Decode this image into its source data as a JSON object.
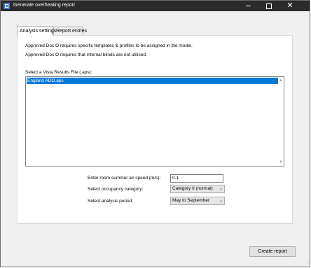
{
  "window": {
    "title": "Generate overheating report",
    "controls": {
      "minimize": "",
      "maximize": "",
      "close": "✕"
    }
  },
  "tabs": [
    {
      "label": "Analysis settings",
      "selected": true
    },
    {
      "label": "Report entries",
      "selected": false
    }
  ],
  "notes": [
    "Approved Doc O requires specific templates & profiles to be assigned in the model.",
    "Approved Doc O requires that internal blinds are not utilised."
  ],
  "results_file": {
    "label": "Select a Vista Results File (.aps):",
    "items": [
      {
        "name": "England ADO.aps",
        "selected": true
      }
    ]
  },
  "form": {
    "air_speed": {
      "label": "Enter room summer air speed (m/s):",
      "value": "0.1"
    },
    "occupancy": {
      "label": "Select occupancy category:",
      "selected": "Category II (normal)"
    },
    "period": {
      "label": "Select analysis period:",
      "selected": "May to September"
    }
  },
  "actions": {
    "create_report": "Create report"
  },
  "colors": {
    "titlebar": "#2b2b2b",
    "selection": "#0078d7",
    "accent_icon": "#3a7bd5"
  },
  "icons": {
    "app": "app-icon",
    "scroll_up": "chevron-up-icon",
    "scroll_down": "chevron-down-icon",
    "dropdown": "chevron-down-icon"
  }
}
